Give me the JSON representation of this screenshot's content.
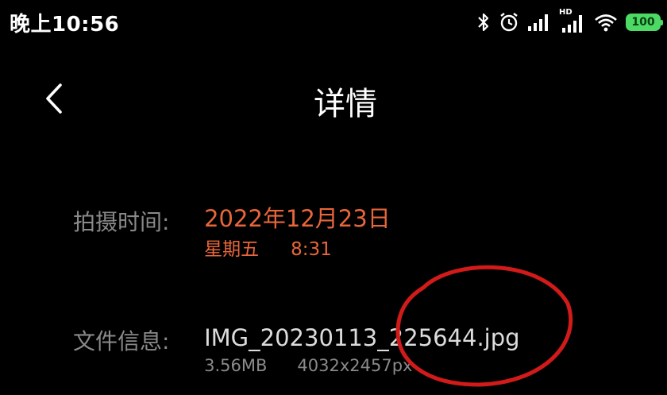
{
  "status_bar": {
    "time": "晚上10:56",
    "battery": "100",
    "icons": [
      "bluetooth-icon",
      "alarm-icon",
      "signal-icon",
      "hd-signal-icon",
      "wifi-icon",
      "battery-icon"
    ],
    "hd_label": "HD"
  },
  "header": {
    "title": "详情",
    "back_icon": "chevron-left-icon"
  },
  "details": {
    "capture_time": {
      "label": "拍摄时间:",
      "date": "2022年12月23日",
      "weekday": "星期五",
      "time": "8:31"
    },
    "file_info": {
      "label": "文件信息:",
      "filename": "IMG_20230113_225644.jpg",
      "size": "3.56MB",
      "dimensions": "4032x2457px"
    }
  },
  "colors": {
    "background": "#000000",
    "accent": "#e8663a",
    "label": "#8a8a8a",
    "annotation": "#d11a1a",
    "battery": "#4cd964"
  }
}
